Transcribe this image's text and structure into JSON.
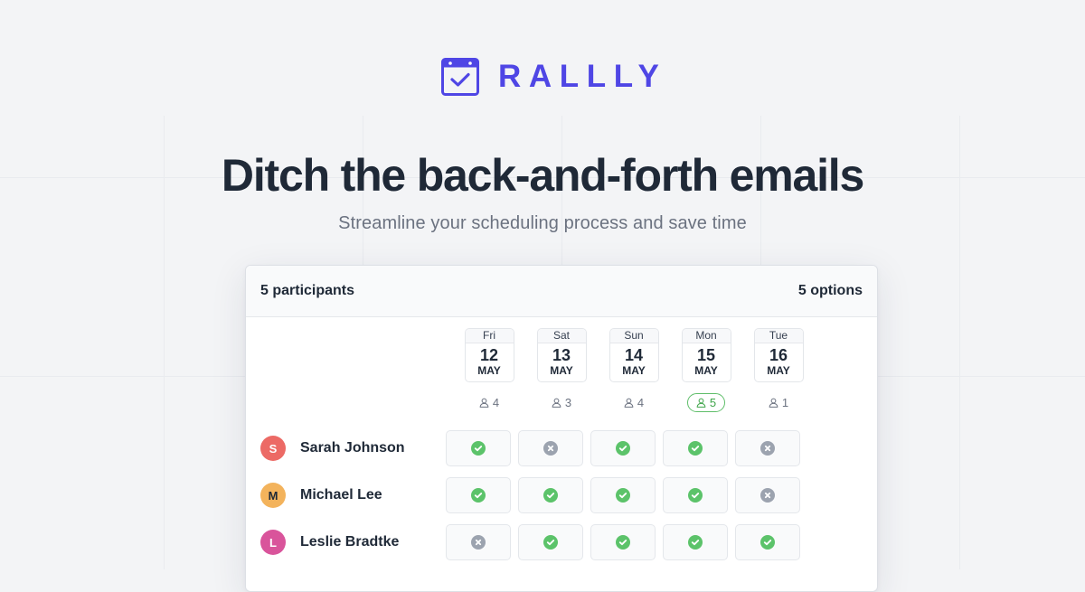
{
  "brand": {
    "name": "RALLLY",
    "color": "#4F46E5"
  },
  "hero": {
    "title": "Ditch the back-and-forth emails",
    "subtitle": "Streamline your scheduling process and save time"
  },
  "poll": {
    "participants_label": "5 participants",
    "options_label": "5 options",
    "options": [
      {
        "dow": "Fri",
        "day": "12",
        "month": "MAY",
        "count": "4",
        "best": false
      },
      {
        "dow": "Sat",
        "day": "13",
        "month": "MAY",
        "count": "3",
        "best": false
      },
      {
        "dow": "Sun",
        "day": "14",
        "month": "MAY",
        "count": "4",
        "best": false
      },
      {
        "dow": "Mon",
        "day": "15",
        "month": "MAY",
        "count": "5",
        "best": true
      },
      {
        "dow": "Tue",
        "day": "16",
        "month": "MAY",
        "count": "1",
        "best": false
      }
    ],
    "participants": [
      {
        "initial": "S",
        "name": "Sarah Johnson",
        "color": "#EC6A65",
        "text_color": "#FFFFFF",
        "votes": [
          "yes",
          "no",
          "yes",
          "yes",
          "no"
        ]
      },
      {
        "initial": "M",
        "name": "Michael Lee",
        "color": "#F3B35C",
        "text_color": "#1F2937",
        "votes": [
          "yes",
          "yes",
          "yes",
          "yes",
          "no"
        ]
      },
      {
        "initial": "L",
        "name": "Leslie Bradtke",
        "color": "#D9549B",
        "text_color": "#FFFFFF",
        "votes": [
          "no",
          "yes",
          "yes",
          "yes",
          "yes"
        ]
      }
    ],
    "vote_colors": {
      "yes": "#5CC36A",
      "no": "#9CA3AF"
    },
    "icons": {
      "count": "user-icon",
      "yes": "check-circle-icon",
      "no": "x-circle-icon"
    }
  }
}
